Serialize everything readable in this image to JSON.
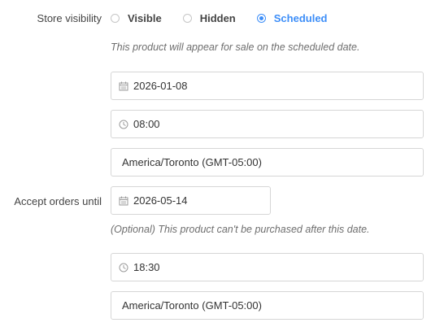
{
  "visibility": {
    "label": "Store visibility",
    "options": [
      {
        "label": "Visible",
        "checked": false
      },
      {
        "label": "Hidden",
        "checked": false
      },
      {
        "label": "Scheduled",
        "checked": true
      }
    ],
    "hint": "This product will appear for sale on the scheduled date.",
    "date": "2026-01-08",
    "time": "08:00",
    "timezone": "America/Toronto (GMT-05:00)"
  },
  "accept_orders": {
    "label": "Accept orders until",
    "date": "2026-05-14",
    "hint": "(Optional) This product can't be purchased after this date.",
    "time": "18:30",
    "timezone": "America/Toronto (GMT-05:00)"
  },
  "colors": {
    "accent": "#3d8ef8",
    "border": "#d6d6d6",
    "icon": "#9a9a9a"
  }
}
